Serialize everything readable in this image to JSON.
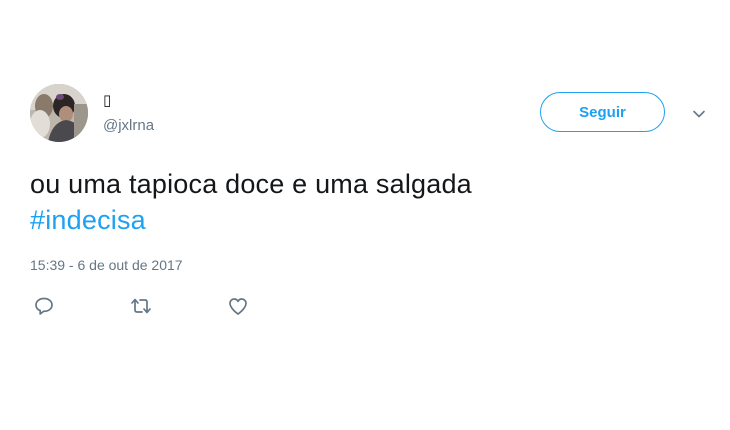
{
  "tweet": {
    "author": {
      "display_name": "▯",
      "handle": "@jxlrna",
      "avatar_icon": "profile-photo"
    },
    "follow_button": {
      "label": "Seguir",
      "color": "#1da1f2"
    },
    "menu_icon": "chevron-down-icon",
    "text_line_1": "ou uma tapioca doce e uma salgada",
    "hashtag": "#indecisa",
    "timestamp": "15:39 - 6 de out de 2017",
    "actions": [
      {
        "name": "reply",
        "icon": "reply-icon"
      },
      {
        "name": "retweet",
        "icon": "retweet-icon"
      },
      {
        "name": "like",
        "icon": "heart-icon"
      }
    ],
    "colors": {
      "text": "#14171a",
      "secondary": "#657786",
      "accent": "#1da1f2"
    }
  }
}
